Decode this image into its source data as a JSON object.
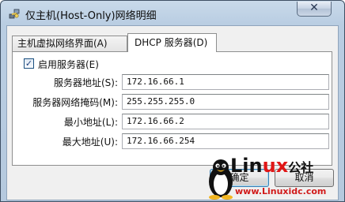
{
  "window": {
    "title": "仅主机(Host-Only)网络明细",
    "close_glyph": "✕"
  },
  "tabs": [
    {
      "label": "主机虚拟网络界面(A)",
      "active": false
    },
    {
      "label": "DHCP 服务器(D)",
      "active": true
    }
  ],
  "dhcp": {
    "enable_label": "启用服务器(E)",
    "enabled": true,
    "fields": [
      {
        "label": "服务器地址(S):",
        "value": "172.16.66.1"
      },
      {
        "label": "服务器网络掩码(M):",
        "value": "255.255.255.0"
      },
      {
        "label": "最小地址(L):",
        "value": "172.16.66.2"
      },
      {
        "label": "最大地址(U):",
        "value": "172.16.66.254"
      }
    ]
  },
  "buttons": {
    "ok": "确定",
    "cancel": "取消"
  },
  "watermark": {
    "brand_prefix": "Lin",
    "brand_suffix": "ux",
    "brand_tail": "公社",
    "url": "www.Linuxidc.com"
  },
  "colors": {
    "title_gradient_top": "#c9daea",
    "title_gradient_bottom": "#b5c9de",
    "client_bg": "#f0f0f0",
    "panel_bg": "#ffffff",
    "watermark_red": "#e01616"
  }
}
